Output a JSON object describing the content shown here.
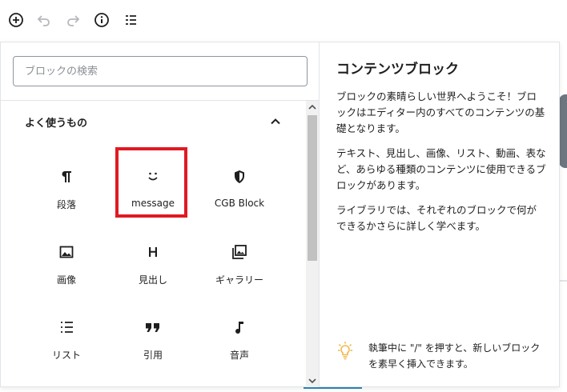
{
  "toolbar": {
    "add_icon": "plus-circle-icon",
    "undo_icon": "undo-icon",
    "redo_icon": "redo-icon",
    "info_icon": "info-icon",
    "outline_icon": "list-outline-icon"
  },
  "inserter": {
    "search": {
      "placeholder": "ブロックの検索",
      "value": ""
    },
    "section": {
      "title": "よく使うもの",
      "collapse_icon": "chevron-up-icon"
    },
    "blocks": [
      {
        "label": "段落",
        "icon": "paragraph-icon"
      },
      {
        "label": "message",
        "icon": "smiley-icon",
        "highlighted": true,
        "highlight_color": "#e01a22"
      },
      {
        "label": "CGB Block",
        "icon": "shield-icon"
      },
      {
        "label": "画像",
        "icon": "image-icon"
      },
      {
        "label": "見出し",
        "icon": "heading-icon"
      },
      {
        "label": "ギャラリー",
        "icon": "gallery-icon"
      },
      {
        "label": "リスト",
        "icon": "list-icon"
      },
      {
        "label": "引用",
        "icon": "quote-icon"
      },
      {
        "label": "音声",
        "icon": "music-note-icon"
      }
    ]
  },
  "info_panel": {
    "title": "コンテンツブロック",
    "paragraphs": [
      "ブロックの素晴らしい世界へようこそ！ブロックはエディター内のすべてのコンテンツの基礎となります。",
      "テキスト、見出し、画像、リスト、動画、表など、あらゆる種類のコンテンツに使用できるブロックがあります。",
      "ライブラリでは、それぞれのブロックで何ができるかさらに詳しく学べます。"
    ],
    "tip": {
      "icon": "lightbulb-icon",
      "text": "執筆中に \"/\" を押すと、新しいブロックを素早く挿入できます。"
    }
  },
  "colors": {
    "highlight": "#e01a22",
    "tip_icon": "#f0b849",
    "text": "#1e1e1e"
  }
}
